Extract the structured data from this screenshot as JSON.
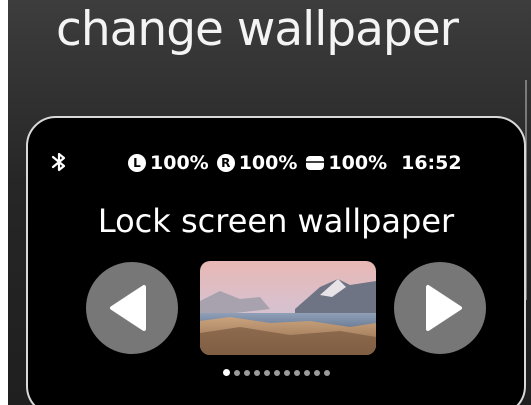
{
  "header": {
    "title": "change wallpaper"
  },
  "status_bar": {
    "bluetooth_icon": "bluetooth-icon",
    "left_earbud": {
      "letter": "L",
      "battery": "100%"
    },
    "right_earbud": {
      "letter": "R",
      "battery": "100%"
    },
    "case": {
      "icon": "charging-case-icon",
      "battery": "100%"
    },
    "time": "16:52"
  },
  "screen": {
    "title": "Lock screen wallpaper",
    "prev_icon": "triangle-left-icon",
    "next_icon": "triangle-right-icon",
    "wallpaper_preview": "mountain-lake-landscape"
  },
  "pagination": {
    "total": 11,
    "current": 1
  },
  "colors": {
    "background": "#262626",
    "device_border": "#d9d9d9",
    "nav_button": "#777777",
    "dot_inactive": "#9a9a9a",
    "dot_active": "#ffffff"
  }
}
